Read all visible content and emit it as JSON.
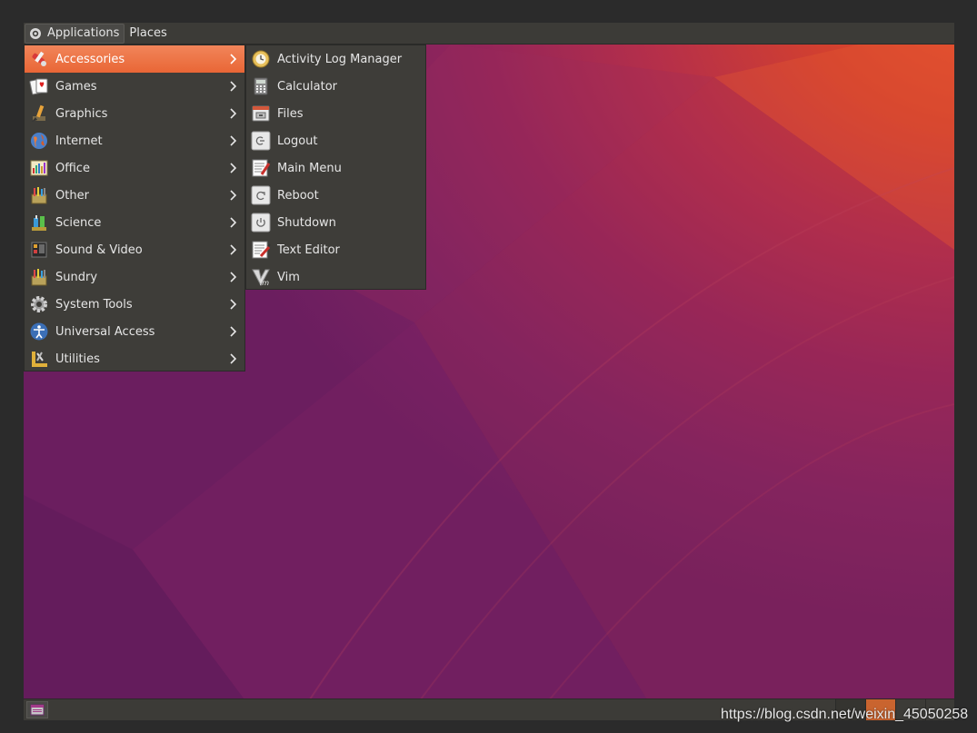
{
  "top_panel": {
    "applications_label": "Applications",
    "places_label": "Places"
  },
  "menu": {
    "categories": [
      {
        "label": "Accessories",
        "icon": "accessories-icon",
        "selected": true
      },
      {
        "label": "Games",
        "icon": "games-icon"
      },
      {
        "label": "Graphics",
        "icon": "graphics-icon"
      },
      {
        "label": "Internet",
        "icon": "internet-icon"
      },
      {
        "label": "Office",
        "icon": "office-icon"
      },
      {
        "label": "Other",
        "icon": "other-icon"
      },
      {
        "label": "Science",
        "icon": "science-icon"
      },
      {
        "label": "Sound & Video",
        "icon": "sound-video-icon"
      },
      {
        "label": "Sundry",
        "icon": "sundry-icon"
      },
      {
        "label": "System Tools",
        "icon": "system-tools-icon"
      },
      {
        "label": "Universal Access",
        "icon": "universal-access-icon"
      },
      {
        "label": "Utilities",
        "icon": "utilities-icon"
      }
    ],
    "accessories": [
      {
        "label": "Activity Log Manager",
        "icon": "activity-log-icon"
      },
      {
        "label": "Calculator",
        "icon": "calculator-icon"
      },
      {
        "label": "Files",
        "icon": "files-icon"
      },
      {
        "label": "Logout",
        "icon": "logout-icon"
      },
      {
        "label": "Main Menu",
        "icon": "main-menu-icon"
      },
      {
        "label": "Reboot",
        "icon": "reboot-icon"
      },
      {
        "label": "Shutdown",
        "icon": "shutdown-icon"
      },
      {
        "label": "Text Editor",
        "icon": "text-editor-icon"
      },
      {
        "label": "Vim",
        "icon": "vim-icon"
      }
    ]
  },
  "watermark": "https://blog.csdn.net/weixin_45050258",
  "colors": {
    "panel": "#3c3b37",
    "menu_bg": "#3e3d39",
    "highlight": "#e96636",
    "text": "#e6e6e6"
  }
}
